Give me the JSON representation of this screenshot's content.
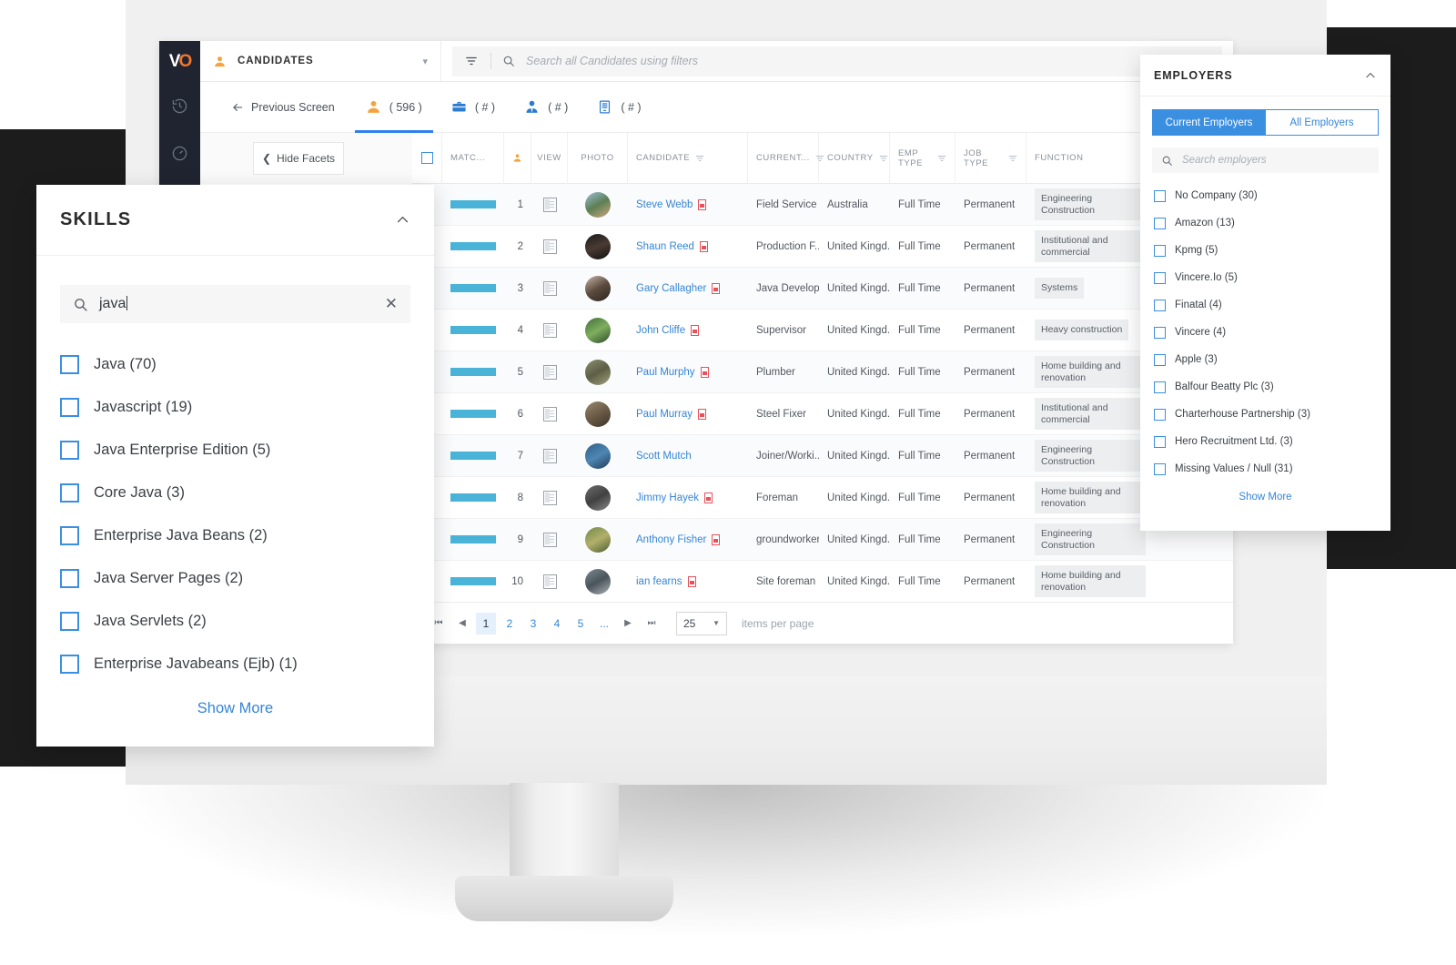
{
  "app": {
    "logo_text": "VO",
    "rail_icons": [
      "history-icon",
      "speedometer-icon",
      "screen-icon"
    ],
    "module_label": "CANDIDATES",
    "module_icon": "person-icon",
    "dropdown_icon": "chevron-down-icon",
    "search": {
      "filter_icon": "filter-icon",
      "search_icon": "search-icon",
      "placeholder": "Search all Candidates using filters"
    }
  },
  "tabs": {
    "previous_screen": "Previous Screen",
    "back_icon": "arrow-left-icon",
    "items": [
      {
        "label": "( 596 )",
        "icon": "person-icon",
        "active": true
      },
      {
        "label": "( # )",
        "icon": "briefcase-icon",
        "active": false
      },
      {
        "label": "( # )",
        "icon": "contact-icon",
        "active": false
      },
      {
        "label": "( # )",
        "icon": "company-icon",
        "active": false
      }
    ]
  },
  "facets": {
    "hide_label": "Hide Facets",
    "hide_icon": "chevron-left-icon"
  },
  "table": {
    "columns": [
      {
        "key": "select",
        "label": "",
        "filter": false
      },
      {
        "key": "match",
        "label": "MATC...",
        "filter": false
      },
      {
        "key": "sort",
        "label": "",
        "filter": false
      },
      {
        "key": "view",
        "label": "VIEW",
        "filter": false
      },
      {
        "key": "photo",
        "label": "PHOTO",
        "filter": false
      },
      {
        "key": "candidate",
        "label": "CANDIDATE",
        "filter": true
      },
      {
        "key": "current",
        "label": "CURRENT...",
        "filter": true
      },
      {
        "key": "country",
        "label": "COUNTRY",
        "filter": true
      },
      {
        "key": "emptype",
        "label": "EMP TYPE",
        "filter": true
      },
      {
        "key": "jobtype",
        "label": "JOB TYPE",
        "filter": true
      },
      {
        "key": "function",
        "label": "FUNCTION",
        "filter": false
      }
    ],
    "rows": [
      {
        "num": "1",
        "name": "Steve Webb",
        "current": "Field Service ...",
        "country": "Australia",
        "emp": "Full Time",
        "job": "Permanent",
        "func": "Engineering Construction",
        "pdf": true
      },
      {
        "num": "2",
        "name": "Shaun Reed",
        "current": "Production F...",
        "country": "United Kingd...",
        "emp": "Full Time",
        "job": "Permanent",
        "func": "Institutional and commercial",
        "pdf": true
      },
      {
        "num": "3",
        "name": "Gary Callagher",
        "current": "Java Developer",
        "country": "United Kingd...",
        "emp": "Full Time",
        "job": "Permanent",
        "func": "Systems",
        "pdf": true
      },
      {
        "num": "4",
        "name": "John Cliffe",
        "current": "Supervisor",
        "country": "United Kingd...",
        "emp": "Full Time",
        "job": "Permanent",
        "func": "Heavy construction",
        "pdf": true
      },
      {
        "num": "5",
        "name": "Paul Murphy",
        "current": "Plumber",
        "country": "United Kingd...",
        "emp": "Full Time",
        "job": "Permanent",
        "func": "Home building and renovation",
        "pdf": true
      },
      {
        "num": "6",
        "name": "Paul Murray",
        "current": "Steel Fixer",
        "country": "United Kingd...",
        "emp": "Full Time",
        "job": "Permanent",
        "func": "Institutional and commercial",
        "pdf": true
      },
      {
        "num": "7",
        "name": "Scott Mutch",
        "current": "Joiner/Worki...",
        "country": "United Kingd...",
        "emp": "Full Time",
        "job": "Permanent",
        "func": "Engineering Construction",
        "pdf": false
      },
      {
        "num": "8",
        "name": "Jimmy Hayek",
        "current": "Foreman",
        "country": "United Kingd...",
        "emp": "Full Time",
        "job": "Permanent",
        "func": "Home building and renovation",
        "pdf": true
      },
      {
        "num": "9",
        "name": "Anthony Fisher",
        "current": "groundworker",
        "country": "United Kingd...",
        "emp": "Full Time",
        "job": "Permanent",
        "func": "Engineering Construction",
        "pdf": true
      },
      {
        "num": "10",
        "name": "ian fearns",
        "current": "Site foreman",
        "country": "United Kingd...",
        "emp": "Full Time",
        "job": "Permanent",
        "func": "Home building and renovation",
        "pdf": true
      }
    ]
  },
  "pager": {
    "first_icon": "first-page-icon",
    "prev_icon": "prev-page-icon",
    "pages": [
      "1",
      "2",
      "3",
      "4",
      "5",
      "..."
    ],
    "current_page": "1",
    "next_icon": "next-page-icon",
    "last_icon": "last-page-icon",
    "items_per_page_value": "25",
    "items_per_page_caret": "▼",
    "items_per_page_label": "items per page"
  },
  "skills_panel": {
    "title": "SKILLS",
    "collapse_icon": "chevron-up-icon",
    "search_icon": "search-icon",
    "search_value": "java",
    "clear_icon": "close-icon",
    "items": [
      "Java (70)",
      "Javascript (19)",
      "Java Enterprise Edition (5)",
      "Core Java (3)",
      "Enterprise Java Beans (2)",
      "Java Server Pages (2)",
      "Java Servlets (2)",
      "Enterprise Javabeans (Ejb) (1)"
    ],
    "show_more": "Show More"
  },
  "employers_panel": {
    "title": "EMPLOYERS",
    "collapse_icon": "chevron-up-icon",
    "tabs": [
      {
        "label": "Current Employers",
        "active": true
      },
      {
        "label": "All Employers",
        "active": false
      }
    ],
    "search_icon": "search-icon",
    "search_placeholder": "Search employers",
    "items": [
      "No Company (30)",
      "Amazon (13)",
      "Kpmg (5)",
      "Vincere.Io (5)",
      "Finatal (4)",
      "Vincere (4)",
      "Apple (3)",
      "Balfour Beatty Plc (3)",
      "Charterhouse Partnership (3)",
      "Hero Recruitment Ltd. (3)",
      "Missing Values / Null (31)"
    ],
    "show_more": "Show More"
  },
  "colors": {
    "accent_blue": "#3b8fe0",
    "link_blue": "#3585d6",
    "orange": "#f4a33c",
    "match_bar": "#4ab3d8",
    "rail_dark": "#1f2430"
  }
}
